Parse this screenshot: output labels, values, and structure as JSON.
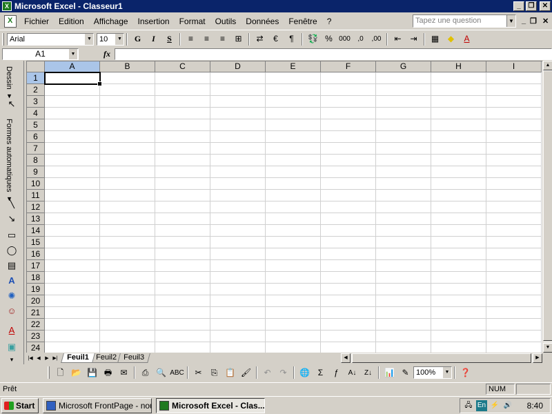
{
  "window": {
    "title": "Microsoft Excel - Classeur1",
    "controls": {
      "minimize": "_",
      "maximize": "❐",
      "close": "✕"
    }
  },
  "menubar": {
    "items": [
      "Fichier",
      "Edition",
      "Affichage",
      "Insertion",
      "Format",
      "Outils",
      "Données",
      "Fenêtre",
      "?"
    ],
    "question_placeholder": "Tapez une question",
    "doc_minimize": "_",
    "doc_restore": "❐",
    "doc_close": "✕"
  },
  "format_toolbar": {
    "font_name": "Arial",
    "font_size": "10",
    "bold": "G",
    "italic": "I",
    "underline": "S",
    "euro": "€",
    "percent": "%",
    "thousands": "000",
    "inc_decimal": ",0",
    "dec_decimal": ",00"
  },
  "formula_bar": {
    "name_box": "A1",
    "fx": "fx",
    "formula": ""
  },
  "drawing_toolbar": {
    "dessin_label": "Dessin ▾",
    "formes_label": "Formes automatiques ▾"
  },
  "grid": {
    "columns": [
      "A",
      "B",
      "C",
      "D",
      "E",
      "F",
      "G",
      "H",
      "I"
    ],
    "rows": [
      "1",
      "2",
      "3",
      "4",
      "5",
      "6",
      "7",
      "8",
      "9",
      "10",
      "11",
      "12",
      "13",
      "14",
      "15",
      "16",
      "17",
      "18",
      "19",
      "20",
      "21",
      "22",
      "23",
      "24"
    ],
    "selected_column": "A",
    "selected_row": "1"
  },
  "sheets": {
    "tabs": [
      "Feuil1",
      "Feuil2",
      "Feuil3"
    ],
    "active": "Feuil1"
  },
  "standard_toolbar": {
    "zoom": "100%",
    "sigma": "Σ"
  },
  "statusbar": {
    "status": "Prêt",
    "num": "NUM"
  },
  "taskbar": {
    "start": "Start",
    "tasks": [
      "Microsoft FrontPage - nou...",
      "Microsoft Excel - Clas..."
    ],
    "language": "En",
    "clock": "8:40"
  },
  "colors": {
    "titlebar": "#0a246a",
    "selected_header": "#aac5e8",
    "excel_green": "#1f7a1f"
  }
}
